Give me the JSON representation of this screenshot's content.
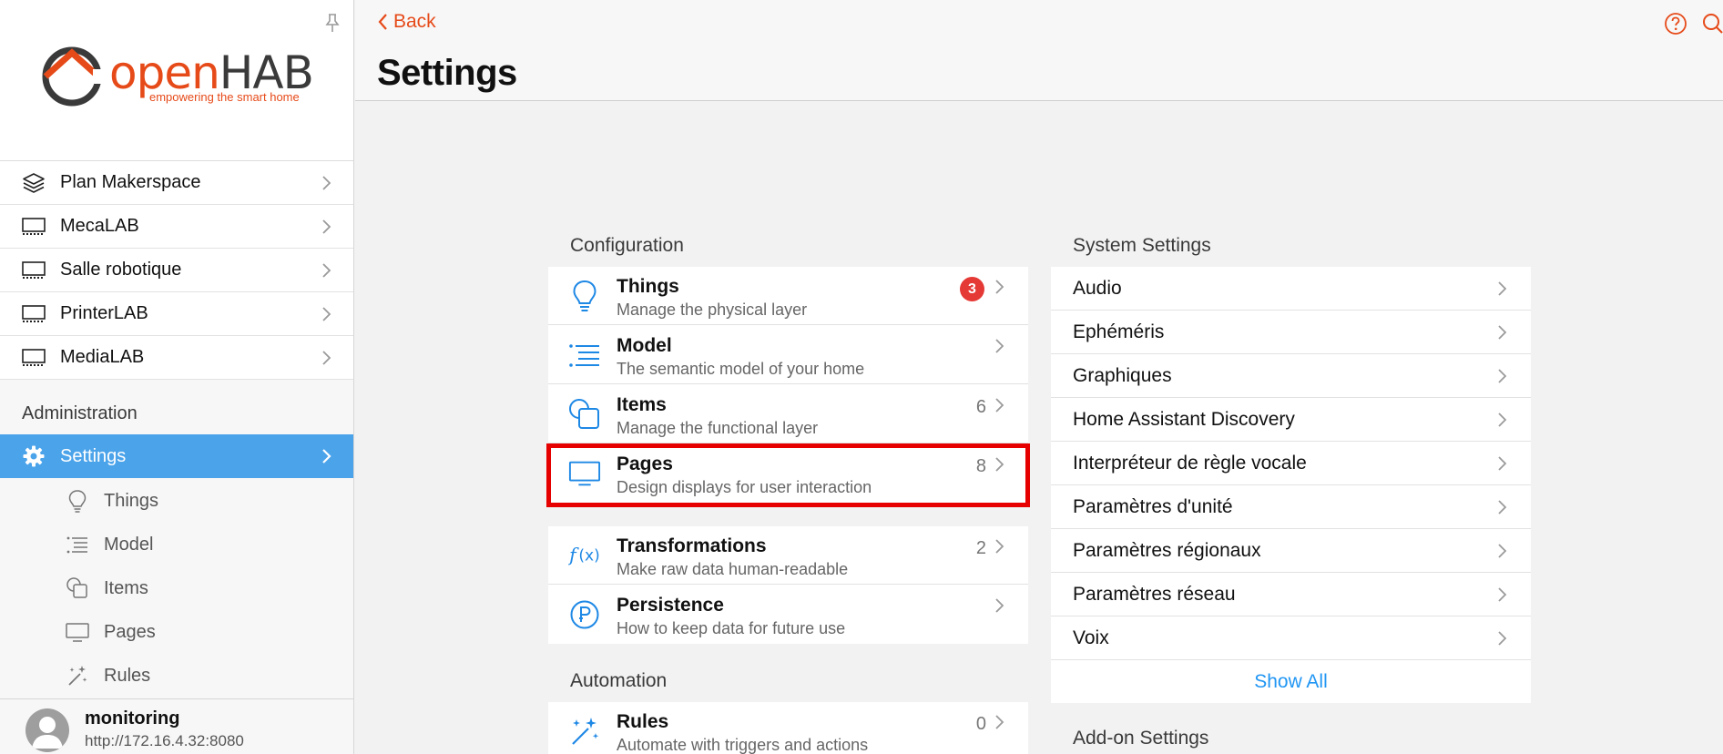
{
  "app": {
    "logo_word_open": "open",
    "logo_word_hab": "HAB",
    "tagline": "empowering the smart home"
  },
  "sidebar": {
    "pages": [
      {
        "label": "Plan Makerspace",
        "icon": "layers-icon"
      },
      {
        "label": "MecaLAB",
        "icon": "monitor-icon"
      },
      {
        "label": "Salle robotique",
        "icon": "monitor-icon"
      },
      {
        "label": "PrinterLAB",
        "icon": "monitor-icon"
      },
      {
        "label": "MediaLAB",
        "icon": "monitor-icon"
      }
    ],
    "admin_title": "Administration",
    "settings_label": "Settings",
    "sub_items": [
      {
        "label": "Things",
        "icon": "lightbulb-icon"
      },
      {
        "label": "Model",
        "icon": "list-icon"
      },
      {
        "label": "Items",
        "icon": "squares-icon"
      },
      {
        "label": "Pages",
        "icon": "monitor-icon"
      },
      {
        "label": "Rules",
        "icon": "wand-icon"
      }
    ],
    "user": {
      "name": "monitoring",
      "url": "http://172.16.4.32:8080"
    }
  },
  "header": {
    "back_label": "Back",
    "title": "Settings"
  },
  "configuration": {
    "title": "Configuration",
    "items": [
      {
        "title": "Things",
        "subtitle": "Manage the physical layer",
        "badge": "3",
        "icon": "lightbulb-icon"
      },
      {
        "title": "Model",
        "subtitle": "The semantic model of your home",
        "icon": "list-icon"
      },
      {
        "title": "Items",
        "subtitle": "Manage the functional layer",
        "count": "6",
        "icon": "squares-icon"
      },
      {
        "title": "Pages",
        "subtitle": "Design displays for user interaction",
        "count": "8",
        "icon": "monitor-icon"
      }
    ],
    "items2": [
      {
        "title": "Transformations",
        "subtitle": "Make raw data human-readable",
        "count": "2",
        "icon": "function-icon"
      },
      {
        "title": "Persistence",
        "subtitle": "How to keep data for future use",
        "icon": "persistence-icon"
      }
    ]
  },
  "automation": {
    "title": "Automation",
    "items": [
      {
        "title": "Rules",
        "subtitle": "Automate with triggers and actions",
        "count": "0",
        "icon": "wand-icon"
      }
    ]
  },
  "system_settings": {
    "title": "System Settings",
    "items": [
      "Audio",
      "Ephéméris",
      "Graphiques",
      "Home Assistant Discovery",
      "Interpréteur de règle vocale",
      "Paramètres d'unité",
      "Paramètres régionaux",
      "Paramètres réseau",
      "Voix"
    ],
    "show_all": "Show All"
  },
  "addon_settings": {
    "title": "Add-on Settings"
  },
  "colors": {
    "accent": "#e64a19",
    "selection": "#4ba3ea",
    "link": "#2196f3",
    "icon_blue": "#1e88e5",
    "badge": "#e53935",
    "highlight": "#e60000"
  }
}
